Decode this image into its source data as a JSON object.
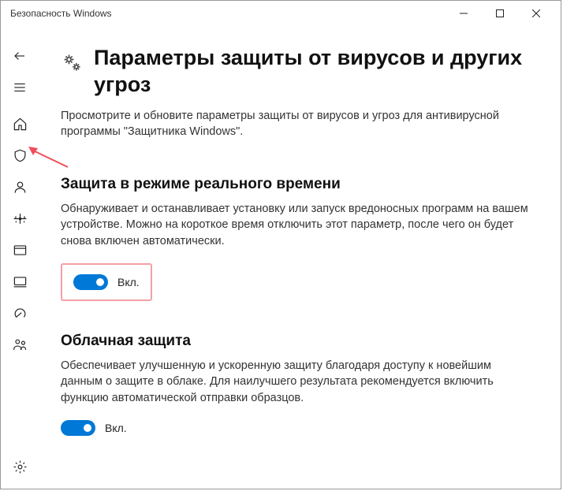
{
  "window": {
    "title": "Безопасность Windows"
  },
  "page": {
    "heading": "Параметры защиты от вирусов и других угроз",
    "intro": "Просмотрите и обновите параметры защиты от вирусов и угроз для антивирусной программы \"Защитника Windows\"."
  },
  "sections": {
    "realtime": {
      "title": "Защита в режиме реального времени",
      "desc": "Обнаруживает и останавливает установку или запуск вредоносных программ на вашем устройстве. Можно на короткое время отключить этот параметр, после чего он будет снова включен автоматически.",
      "toggle_label": "Вкл."
    },
    "cloud": {
      "title": "Облачная защита",
      "desc": "Обеспечивает улучшенную и ускоренную защиту благодаря доступу к новейшим данным о защите в облаке. Для наилучшего результата рекомендуется включить функцию автоматической отправки образцов.",
      "toggle_label": "Вкл."
    }
  }
}
